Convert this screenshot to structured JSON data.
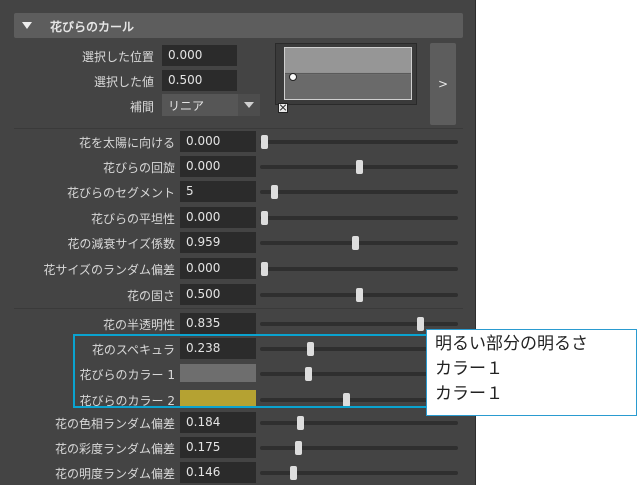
{
  "section": {
    "title": "花びらのカール"
  },
  "ramp": {
    "selected_position_label": "選択した位置",
    "selected_position_value": "0.000",
    "selected_value_label": "選択した値",
    "selected_value_value": "0.500",
    "interpolation_label": "補間",
    "interpolation_value": "リニア",
    "expand_label": ">"
  },
  "sliders": [
    {
      "label": "花を太陽に向ける",
      "value": "0.000",
      "level": 0.0
    },
    {
      "label": "花びらの回旋",
      "value": "0.000",
      "level": 0.5
    },
    {
      "label": "花びらのセグメント",
      "value": "5",
      "level": 0.05
    },
    {
      "label": "花びらの平坦性",
      "value": "0.000",
      "level": 0.0
    },
    {
      "label": "花の減衰サイズ係数",
      "value": "0.959",
      "level": 0.48
    },
    {
      "label": "花サイズのランダム偏差",
      "value": "0.000",
      "level": 0.0
    },
    {
      "label": "花の固さ",
      "value": "0.500",
      "level": 0.5
    },
    {
      "label": "花の半透明性",
      "value": "0.835",
      "level": 0.82
    },
    {
      "label": "花のスペキュラ",
      "value": "0.238",
      "level": 0.24
    }
  ],
  "colors": [
    {
      "label": "花びらのカラー 1",
      "swatch": "#6e6e6e",
      "level": 0.23
    },
    {
      "label": "花びらのカラー 2",
      "swatch": "#b5a232",
      "level": 0.43
    }
  ],
  "sliders_bottom": [
    {
      "label": "花の色相ランダム偏差",
      "value": "0.184",
      "level": 0.19
    },
    {
      "label": "花の彩度ランダム偏差",
      "value": "0.175",
      "level": 0.18
    },
    {
      "label": "花の明度ランダム偏差",
      "value": "0.146",
      "level": 0.15
    }
  ],
  "callout": {
    "line1": "明るい部分の明るさ",
    "line2": "カラー１",
    "line3": "カラー１"
  }
}
